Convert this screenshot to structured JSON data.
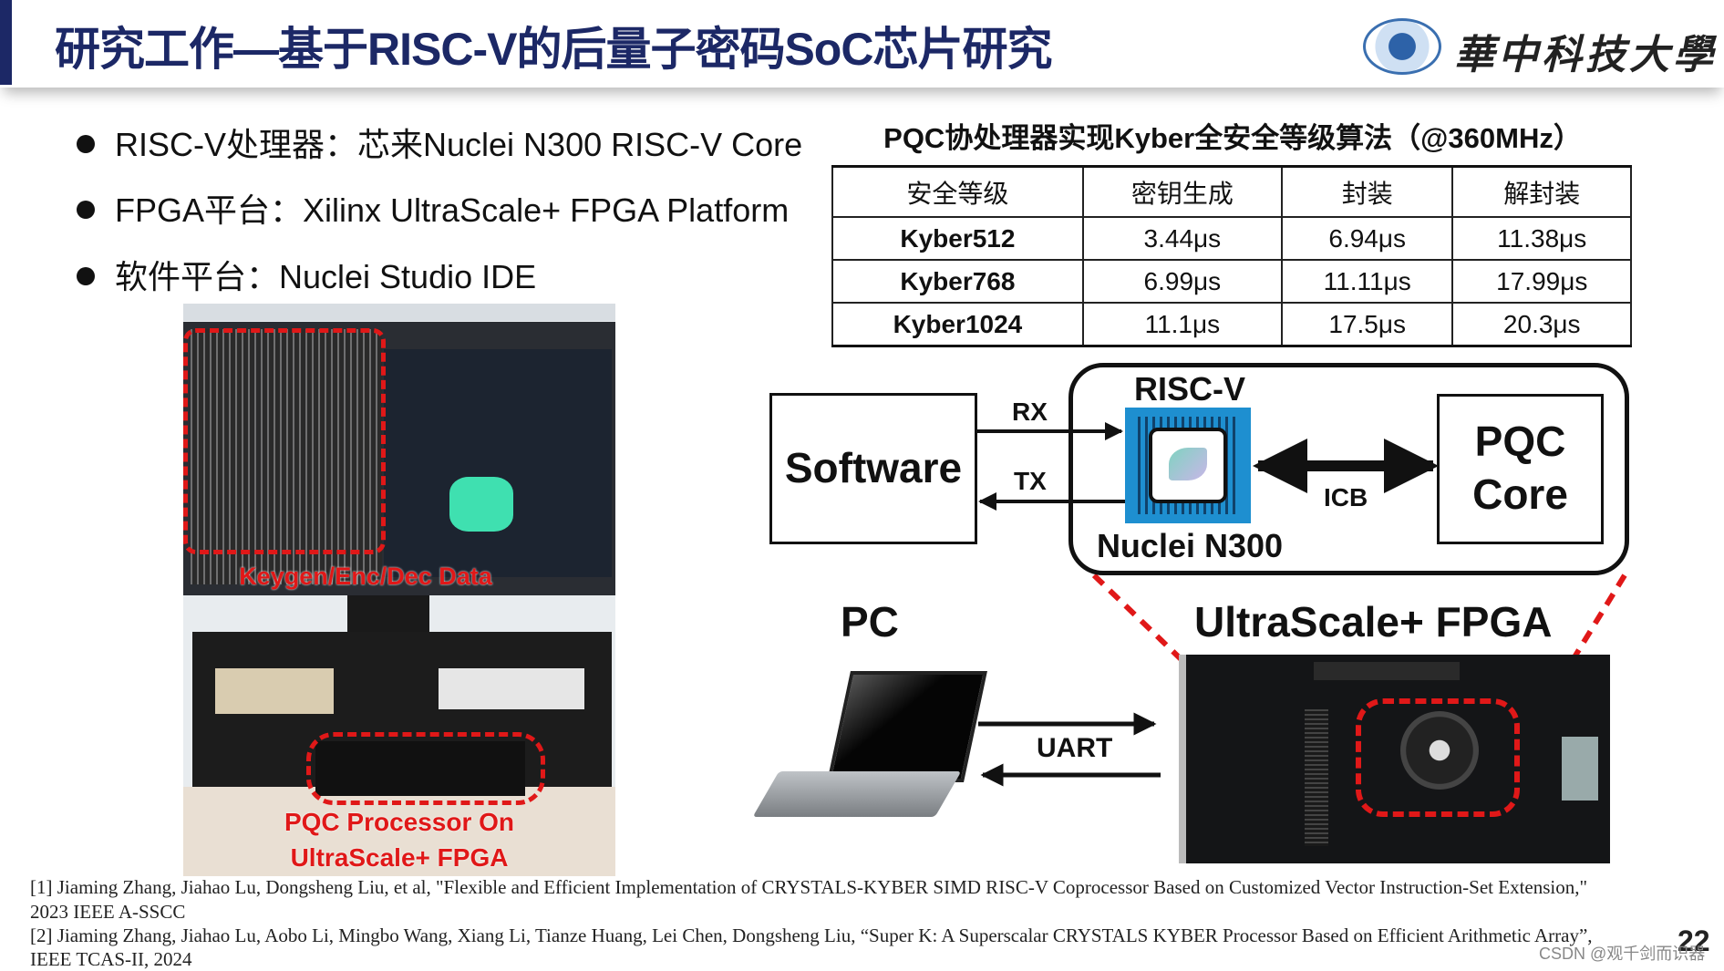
{
  "header": {
    "title": "研究工作—基于RISC-V的后量子密码SoC芯片研究",
    "logo_text": "華中科技大學"
  },
  "bullets": [
    "RISC-V处理器：芯来Nuclei N300 RISC-V Core",
    "FPGA平台：Xilinx UltraScale+ FPGA Platform",
    "软件平台：Nuclei Studio IDE"
  ],
  "table": {
    "title": "PQC协处理器实现Kyber全安全等级算法（@360MHz）",
    "headers": [
      "安全等级",
      "密钥生成",
      "封装",
      "解封装"
    ],
    "rows": [
      [
        "Kyber512",
        "3.44μs",
        "6.94μs",
        "11.38μs"
      ],
      [
        "Kyber768",
        "6.99μs",
        "11.11μs",
        "17.99μs"
      ],
      [
        "Kyber1024",
        "11.1μs",
        "17.5μs",
        "20.3μs"
      ]
    ]
  },
  "photo": {
    "label_top": "Keygen/Enc/Dec Data",
    "label_bottom_1": "PQC Processor On",
    "label_bottom_2": "UltraScale+ FPGA"
  },
  "diagram": {
    "software": "Software",
    "rx": "RX",
    "tx": "TX",
    "riscv": "RISC-V",
    "nuclei": "Nuclei N300",
    "icb": "ICB",
    "pqc_1": "PQC",
    "pqc_2": "Core",
    "pc": "PC",
    "fpga": "UltraScale+ FPGA",
    "uart": "UART"
  },
  "references": [
    "[1] Jiaming Zhang, Jiahao Lu, Dongsheng Liu, et al, \"Flexible and Efficient Implementation of CRYSTALS-KYBER SIMD RISC-V Coprocessor Based on Customized Vector Instruction-Set Extension,\"",
    "2023 IEEE A-SSCC",
    "[2] Jiaming Zhang, Jiahao Lu, Aobo Li, Mingbo Wang, Xiang Li, Tianze Huang, Lei Chen, Dongsheng Liu, “Super K: A Superscalar CRYSTALS KYBER Processor Based on Efficient Arithmetic Array”,",
    "IEEE TCAS-II, 2024"
  ],
  "page_number": "22",
  "watermark": "CSDN @观千剑而识器",
  "colors": {
    "title": "#1c2866",
    "highlight": "#e01818",
    "chip": "#1e8fd0"
  }
}
